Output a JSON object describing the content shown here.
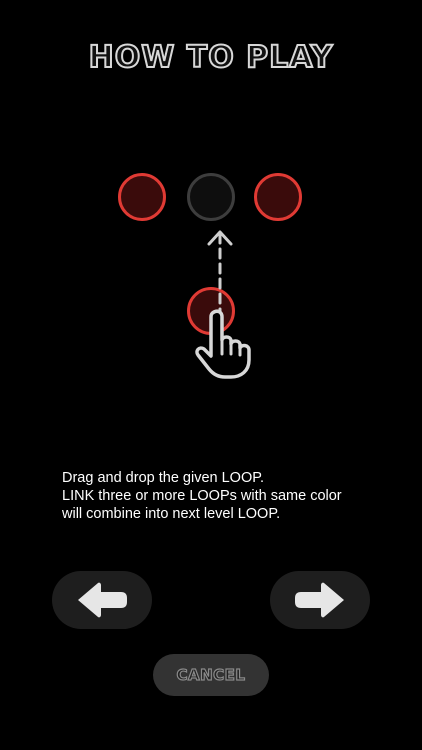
{
  "header": {
    "title": "HOW TO PLAY"
  },
  "demo": {
    "top_row": [
      {
        "state": "red"
      },
      {
        "state": "empty"
      },
      {
        "state": "red"
      }
    ],
    "dragged_loop": {
      "state": "red"
    },
    "gesture": "drag-up",
    "icons": [
      "dashed-arrow-up-icon",
      "hand-pointer-icon"
    ]
  },
  "instructions": {
    "line1": "Drag and drop the given LOOP.",
    "line2": "LINK three or more LOOPs with same color",
    "line3": "will combine into next level LOOP."
  },
  "navigation": {
    "prev_icon": "arrow-left-icon",
    "next_icon": "arrow-right-icon"
  },
  "cancel": {
    "label": "CANCEL"
  },
  "colors": {
    "background": "#000000",
    "loop_red_border": "#e03a34",
    "loop_red_fill": "#3a0b0b",
    "loop_empty_border": "#3d3d3d",
    "button_bg": "#1e1e1e",
    "cancel_bg": "#333333",
    "title_outline": "#d8d8d8"
  }
}
